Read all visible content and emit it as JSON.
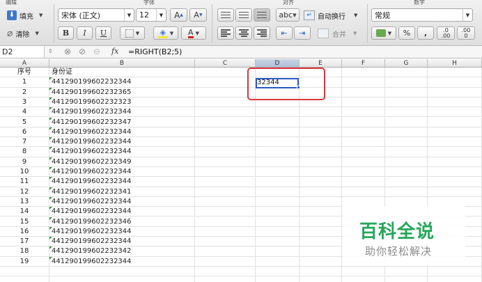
{
  "ribbon": {
    "groups": {
      "edit": "编辑",
      "font": "字体",
      "align": "对齐",
      "number": "数字"
    },
    "fill_label": "填充",
    "clear_label": "清除",
    "font_name": "宋体 (正文)",
    "font_size": "12",
    "grow_font": "A",
    "shrink_font": "A",
    "bold": "B",
    "italic": "I",
    "underline": "U",
    "font_color": "A",
    "wrap_label": "abc",
    "auto_wrap": "自动换行",
    "merge": "合并",
    "number_format": "常规",
    "percent": "%",
    "comma": ",",
    "dec_inc_top": ".0",
    "dec_inc_bottom": ".00",
    "dec_dec_top": ".00",
    "dec_dec_bottom": "0"
  },
  "formula_bar": {
    "name_box": "D2",
    "fx": "fx",
    "formula": "=RIGHT(B2;5)"
  },
  "columns": [
    "A",
    "B",
    "C",
    "D",
    "E",
    "F",
    "G",
    "H"
  ],
  "sheet": {
    "header_a": "序号",
    "header_b": "身份证",
    "rows": [
      {
        "n": "1",
        "id": "441290199602232344"
      },
      {
        "n": "2",
        "id": "441290199602232365"
      },
      {
        "n": "3",
        "id": "441290199602232323"
      },
      {
        "n": "4",
        "id": "441290199602232344"
      },
      {
        "n": "5",
        "id": "441290199602232347"
      },
      {
        "n": "6",
        "id": "441290199602232344"
      },
      {
        "n": "7",
        "id": "441290199602232344"
      },
      {
        "n": "8",
        "id": "441290199602232344"
      },
      {
        "n": "9",
        "id": "441290199602232349"
      },
      {
        "n": "10",
        "id": "441290199602232344"
      },
      {
        "n": "11",
        "id": "441290199602232344"
      },
      {
        "n": "12",
        "id": "441290199602232341"
      },
      {
        "n": "13",
        "id": "441290199602232344"
      },
      {
        "n": "14",
        "id": "441290199602232344"
      },
      {
        "n": "15",
        "id": "441290199602232346"
      },
      {
        "n": "16",
        "id": "441290199602232344"
      },
      {
        "n": "17",
        "id": "441290199602232344"
      },
      {
        "n": "18",
        "id": "441290199602232342"
      },
      {
        "n": "19",
        "id": "441290199602232344"
      }
    ],
    "d2_value": "32344"
  },
  "watermark": {
    "main": "百科全说",
    "sub": "助你轻松解决"
  },
  "colors": {
    "selection": "#2b59c3",
    "highlight": "#d9363e",
    "watermark": "#27a65a"
  }
}
